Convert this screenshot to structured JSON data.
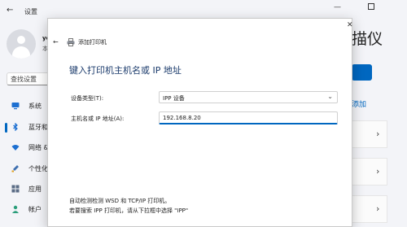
{
  "app": {
    "title": "设置",
    "back": "←",
    "min": "—"
  },
  "user": {
    "name": "ye",
    "sub": "本"
  },
  "search": {
    "placeholder": "查找设置"
  },
  "nav": [
    {
      "label": "系统",
      "icon": "monitor-icon",
      "selected": false
    },
    {
      "label": "蓝牙和",
      "icon": "bluetooth-icon",
      "selected": true
    },
    {
      "label": "网络 &",
      "icon": "wifi-icon",
      "selected": false
    },
    {
      "label": "个性化",
      "icon": "brush-icon",
      "selected": false
    },
    {
      "label": "应用",
      "icon": "apps-icon",
      "selected": false
    },
    {
      "label": "帐户",
      "icon": "account-icon",
      "selected": false
    }
  ],
  "right": {
    "title": "描仪",
    "add_link": "添加",
    "chevron": "›"
  },
  "dialog": {
    "close": "✕",
    "back": "←",
    "title": "添加打印机",
    "heading": "键入打印机主机名或 IP 地址",
    "device_type_label": "设备类型(T):",
    "device_type_value": "IPP 设备",
    "hostname_label": "主机名或 IP 地址(A):",
    "hostname_value": "192.168.8.20",
    "hint_line1": "自动检测检测 WSD 和 TCP/IP 打印机。",
    "hint_line2": "若要搜索 IPP 打印机，请从下拉框中选择 \"IPP\"",
    "dropdown_chevron": "⌄"
  }
}
